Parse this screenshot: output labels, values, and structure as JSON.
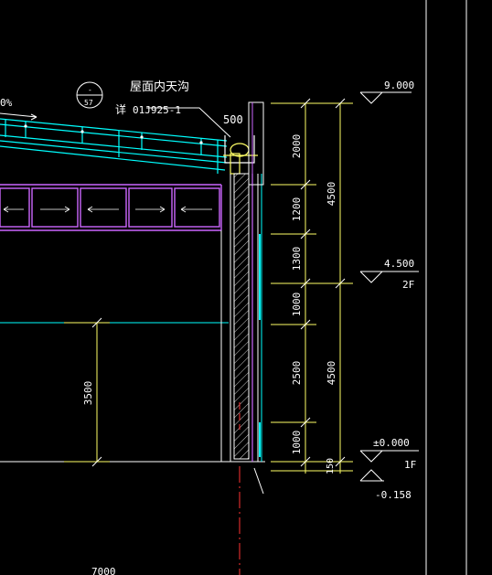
{
  "callout": {
    "title": "屋面内天沟",
    "ref_prefix": "详",
    "ref_code": "01J925-1",
    "bubble_top": "-",
    "bubble_bottom": "57"
  },
  "slope_label": "0%",
  "gutter_width": "500",
  "dims_inner": [
    "2000",
    "1200",
    "1300",
    "1000",
    "2500",
    "1000",
    "150"
  ],
  "dims_outer": [
    "4500",
    "4500"
  ],
  "dim_left": "3500",
  "dim_bottom": "7000",
  "levels": [
    {
      "value": "9.000",
      "floor": ""
    },
    {
      "value": "4.500",
      "floor": "2F"
    },
    {
      "value": "±0.000",
      "floor": "1F"
    },
    {
      "value": "-0.158",
      "floor": ""
    }
  ],
  "colors": {
    "background": "#000000",
    "structure": "#ffffff",
    "roof": "#00ffff",
    "window": "#cc66ff",
    "dimension": "#ffff66",
    "axis": "#ff3333"
  }
}
